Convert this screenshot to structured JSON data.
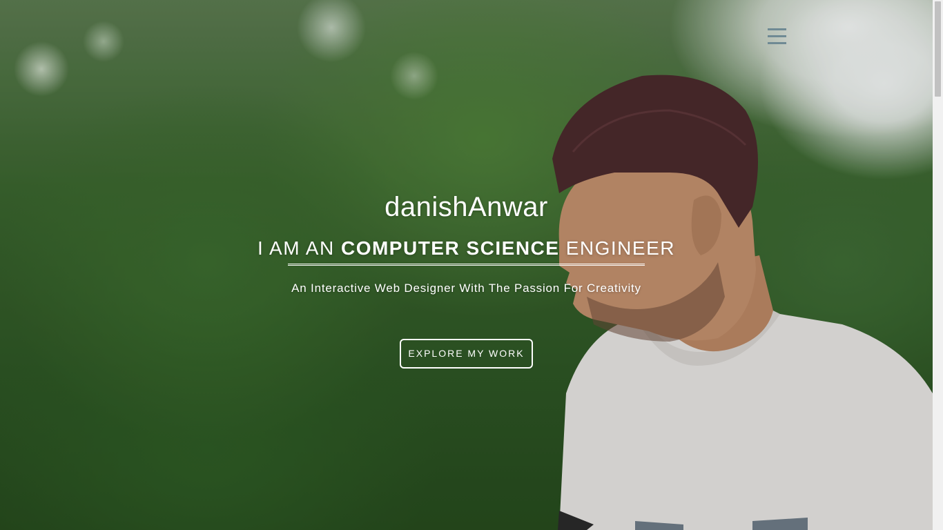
{
  "hero": {
    "name": "danishAnwar",
    "title_prefix": "I AM AN ",
    "title_bold": "COMPUTER SCIENCE",
    "title_suffix": " ENGINEER",
    "tagline": "An Interactive Web Designer With The Passion For Creativity",
    "cta_label": "EXPLORE MY WORK"
  },
  "nav": {
    "menu_icon": "hamburger-menu-icon"
  },
  "colors": {
    "text": "#ffffff",
    "menu_icon": "#6f8a94",
    "scrollbar_track": "#f1f1f1",
    "scrollbar_thumb": "#c1c1c1"
  }
}
